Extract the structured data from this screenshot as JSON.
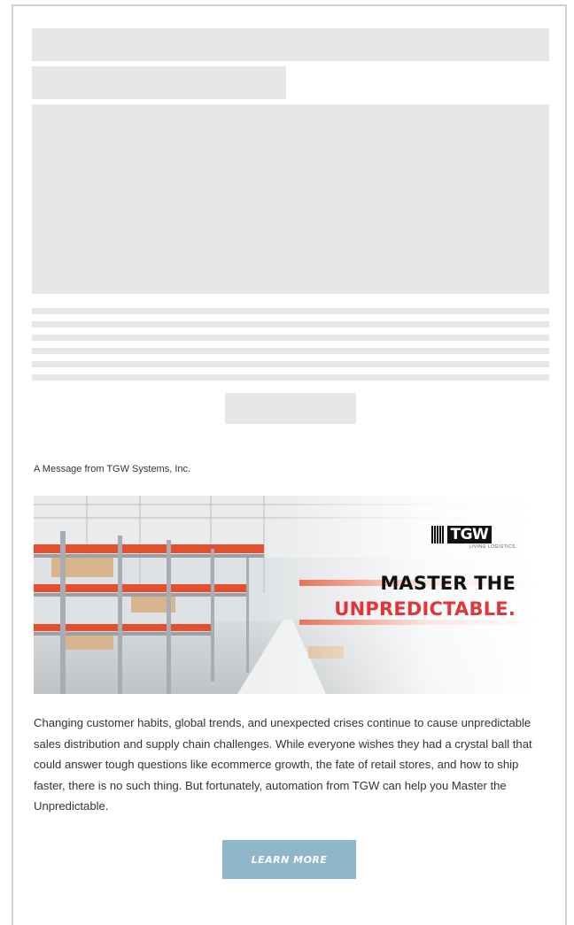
{
  "sponsor": {
    "label": "A Message from TGW Systems, Inc."
  },
  "hero": {
    "logo_wordmark": "TGW",
    "logo_tagline": "LIVING LOGISTICS",
    "headline_line1": "MASTER THE",
    "headline_line2": "UNPREDICTABLE.",
    "headline_accent_color": "#e0363a"
  },
  "body": {
    "paragraph": "Changing customer habits, global trends, and unexpected crises continue to cause unpredictable sales distribution and supply chain challenges. While everyone wishes they had a crystal ball that could answer tough questions like ecommerce growth, the fate of retail stores, and how to ship faster, there is no such thing. But fortunately, automation from TGW can help you Master the Unpredictable."
  },
  "cta": {
    "label": "LEARN MORE",
    "color": "#8fb6c9"
  },
  "placeholder_color": "#e6e7e8"
}
